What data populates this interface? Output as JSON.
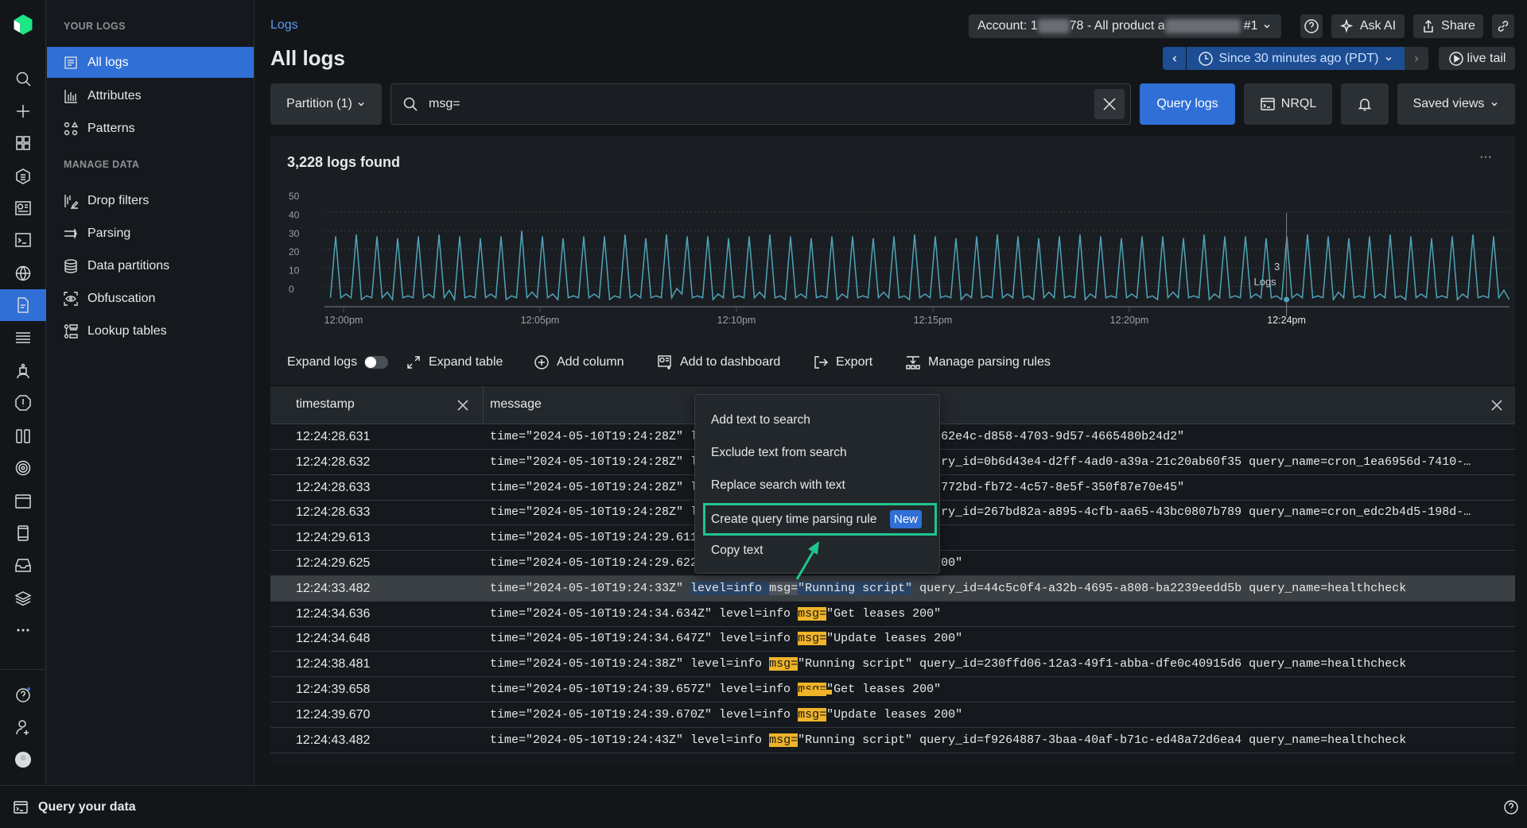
{
  "rail": {
    "icons": [
      "logo-icon",
      "search-icon",
      "plus-icon",
      "apps-grid-icon",
      "entity-list-icon",
      "dashboard-icon",
      "terminal-icon",
      "globe-icon",
      "logs-icon",
      "sliders-icon",
      "robot-icon",
      "alert-icon",
      "columns-icon",
      "target-icon",
      "browser-icon",
      "mobile-icon",
      "inbox-icon",
      "layers-icon",
      "more-icon",
      "help-icon",
      "add-user-icon",
      "avatar"
    ],
    "active": "logs-icon"
  },
  "sidebar": {
    "section1": "YOUR LOGS",
    "section2": "MANAGE DATA",
    "items": [
      {
        "label": "All logs",
        "icon": "list-doc-icon",
        "active": true
      },
      {
        "label": "Attributes",
        "icon": "bar-chart-icon"
      },
      {
        "label": "Patterns",
        "icon": "shapes-icon"
      },
      {
        "label": "Drop filters",
        "icon": "drop-filter-icon"
      },
      {
        "label": "Parsing",
        "icon": "parsing-icon"
      },
      {
        "label": "Data partitions",
        "icon": "database-icon"
      },
      {
        "label": "Obfuscation",
        "icon": "eye-icon"
      },
      {
        "label": "Lookup tables",
        "icon": "lookup-table-icon"
      }
    ]
  },
  "header": {
    "breadcrumb": "Logs",
    "title": "All logs",
    "account_prefix": "Account: 1",
    "account_mid": "78 - All product a",
    "account_suffix": "#1",
    "ask_ai": "Ask AI",
    "share": "Share",
    "time_range": "Since 30 minutes ago (PDT)",
    "live_tail": "live tail"
  },
  "search": {
    "partition": "Partition (1)",
    "query": "msg=",
    "query_button": "Query logs",
    "nrql": "NRQL",
    "saved_views": "Saved views"
  },
  "results": {
    "count": "3,228 logs found",
    "more": "···"
  },
  "colors": {
    "accent": "#2f6fd6",
    "line": "#4fa3b8",
    "match": "#f0b429",
    "highlight_box": "#1fc58e"
  },
  "chart_data": {
    "type": "line",
    "title": "",
    "xlabel": "",
    "ylabel": "",
    "ylim": [
      0,
      50
    ],
    "yticks": [
      0,
      10,
      20,
      30,
      40,
      50
    ],
    "x_start": "11:59:40",
    "x_end": "12:29:40",
    "xticks": [
      "12:00pm",
      "12:05pm",
      "12:10pm",
      "12:15pm",
      "12:20pm",
      "12:24pm"
    ],
    "grid": true,
    "series": [
      {
        "values": [
          1,
          34,
          1,
          3,
          1,
          35,
          0,
          2,
          1,
          34,
          1,
          4,
          0,
          33,
          1,
          2,
          1,
          34,
          1,
          3,
          1,
          35,
          1,
          5,
          0,
          34,
          1,
          2,
          1,
          33,
          1,
          3,
          1,
          34,
          0,
          2,
          1,
          37,
          1,
          4,
          1,
          34,
          1,
          3,
          0,
          33,
          1,
          2,
          1,
          34,
          1,
          3,
          1,
          34,
          0,
          2,
          1,
          35,
          1,
          3,
          1,
          33,
          1,
          2,
          1,
          35,
          1,
          6,
          3,
          34,
          1,
          2,
          1,
          34,
          0,
          3,
          1,
          33,
          1,
          2,
          1,
          34,
          1,
          4,
          1,
          35,
          1,
          2,
          0,
          34,
          1,
          3,
          1,
          33,
          1,
          2,
          1,
          34,
          0,
          3,
          1,
          34,
          1,
          2,
          1,
          33,
          1,
          4,
          1,
          34,
          1,
          2,
          0,
          35,
          1,
          3,
          1,
          34,
          1,
          2,
          1,
          33,
          0,
          3,
          1,
          34,
          1,
          2,
          1,
          35,
          1,
          3,
          1,
          34,
          1,
          2,
          0,
          33,
          1,
          4,
          1,
          34,
          1,
          2,
          1,
          35,
          0,
          3,
          1,
          34,
          1,
          2,
          1,
          33,
          1,
          3,
          1,
          34,
          1,
          2,
          0,
          34,
          1,
          4,
          1,
          33,
          1,
          2,
          1,
          35,
          0,
          3,
          1,
          34,
          1,
          2,
          1,
          34,
          1,
          3,
          1,
          33,
          1,
          2,
          0,
          34,
          1,
          3,
          1,
          35,
          1,
          2,
          1,
          34,
          0,
          4,
          1,
          33,
          1,
          2,
          1,
          34,
          1,
          3,
          1,
          35,
          1,
          2,
          0,
          34,
          1,
          3,
          1,
          33,
          1,
          2,
          1,
          34,
          0,
          3,
          1,
          35,
          1,
          2,
          1,
          34,
          1,
          5,
          0
        ]
      }
    ],
    "tooltip": {
      "time": "12:24pm",
      "value": "3",
      "label": "Logs"
    }
  },
  "toolbar": {
    "expand_logs": "Expand logs",
    "expand_logs_on": false,
    "expand_table": "Expand table",
    "add_column": "Add column",
    "add_dashboard": "Add to dashboard",
    "export": "Export",
    "manage_parsing": "Manage parsing rules"
  },
  "table": {
    "columns": [
      "timestamp",
      "message"
    ],
    "rows": [
      {
        "ts": "12:24:28.631",
        "seg": [
          [
            "time=\"2024-05-10T19:24:28Z\" level=info msg=\"Completed query f5262e4c-d858-4703-9d57-4665480b24d2\"",
            ""
          ]
        ]
      },
      {
        "ts": "12:24:28.632",
        "seg": [
          [
            "time=\"2024-05-10T19:24:28Z\" level=info msg=\"Running script\" query_id=0b6d43e4-d2ff-4ad0-a39a-21c20ab60f35 query_name=cron_1ea6956d-7410-…",
            ""
          ]
        ]
      },
      {
        "ts": "12:24:28.633",
        "seg": [
          [
            "time=\"2024-05-10T19:24:28Z\" level=info msg=\"Completed query d09772bd-fb72-4c57-8e5f-350f87e70e45\"",
            ""
          ]
        ]
      },
      {
        "ts": "12:24:28.633",
        "seg": [
          [
            "time=\"2024-05-10T19:24:28Z\" level=info msg=\"Running script\" query_id=267bd82a-a895-4cfb-aa65-43bc0807b789 query_name=cron_edc2b4d5-198d-…",
            ""
          ]
        ]
      },
      {
        "ts": "12:24:29.613",
        "seg": [
          [
            "time=\"2024-05-10T19:24:29.611Z\" level=info msg=\"Get leases 200\"",
            ""
          ]
        ]
      },
      {
        "ts": "12:24:29.625",
        "seg": [
          [
            "time=\"2024-05-10T19:24:29.622Z\" level=info msg=\"Update leases 200\"",
            ""
          ]
        ]
      },
      {
        "ts": "12:24:33.482",
        "selected": true,
        "seg": [
          [
            "time=\"2024-05-10T19:24:33Z\" ",
            ""
          ],
          [
            "level=info ",
            "selhl"
          ],
          [
            "msg=",
            "selkey"
          ],
          [
            "\"Running script\"",
            "selhl"
          ],
          [
            " query_id=44c5c0f4-a32b-4695-a808-ba2239eedd5b query_name=healthcheck",
            ""
          ]
        ]
      },
      {
        "ts": "12:24:34.636",
        "seg": [
          [
            "time=\"2024-05-10T19:24:34.634Z\" level=info ",
            ""
          ],
          [
            "msg=",
            "match"
          ],
          [
            "\"Get leases 200\"",
            ""
          ]
        ]
      },
      {
        "ts": "12:24:34.648",
        "seg": [
          [
            "time=\"2024-05-10T19:24:34.647Z\" level=info ",
            ""
          ],
          [
            "msg=",
            "match"
          ],
          [
            "\"Update leases 200\"",
            ""
          ]
        ]
      },
      {
        "ts": "12:24:38.481",
        "seg": [
          [
            "time=\"2024-05-10T19:24:38Z\" level=info ",
            ""
          ],
          [
            "msg=",
            "match"
          ],
          [
            "\"Running script\" query_id=230ffd06-12a3-49f1-abba-dfe0c40915d6 query_name=healthcheck",
            ""
          ]
        ]
      },
      {
        "ts": "12:24:39.658",
        "seg": [
          [
            "time=\"2024-05-10T19:24:39.657Z\" level=info ",
            ""
          ],
          [
            "msg=",
            "match"
          ],
          [
            "\"Get leases 200\"",
            ""
          ]
        ]
      },
      {
        "ts": "12:24:39.670",
        "seg": [
          [
            "time=\"2024-05-10T19:24:39.670Z\" level=info ",
            ""
          ],
          [
            "msg=",
            "match"
          ],
          [
            "\"Update leases 200\"",
            ""
          ]
        ]
      },
      {
        "ts": "12:24:43.482",
        "seg": [
          [
            "time=\"2024-05-10T19:24:43Z\" level=info ",
            ""
          ],
          [
            "msg=",
            "match"
          ],
          [
            "\"Running script\" query_id=f9264887-3baa-40af-b71c-ed48a72d6ea4 query_name=healthcheck",
            ""
          ]
        ]
      }
    ]
  },
  "context_menu": {
    "items": [
      "Add text to search",
      "Exclude text from search",
      "Replace search with text",
      "Create query time parsing rule",
      "Copy text"
    ],
    "badge": "New",
    "highlighted": "Create query time parsing rule"
  },
  "bottom": {
    "query_your_data": "Query your data"
  }
}
